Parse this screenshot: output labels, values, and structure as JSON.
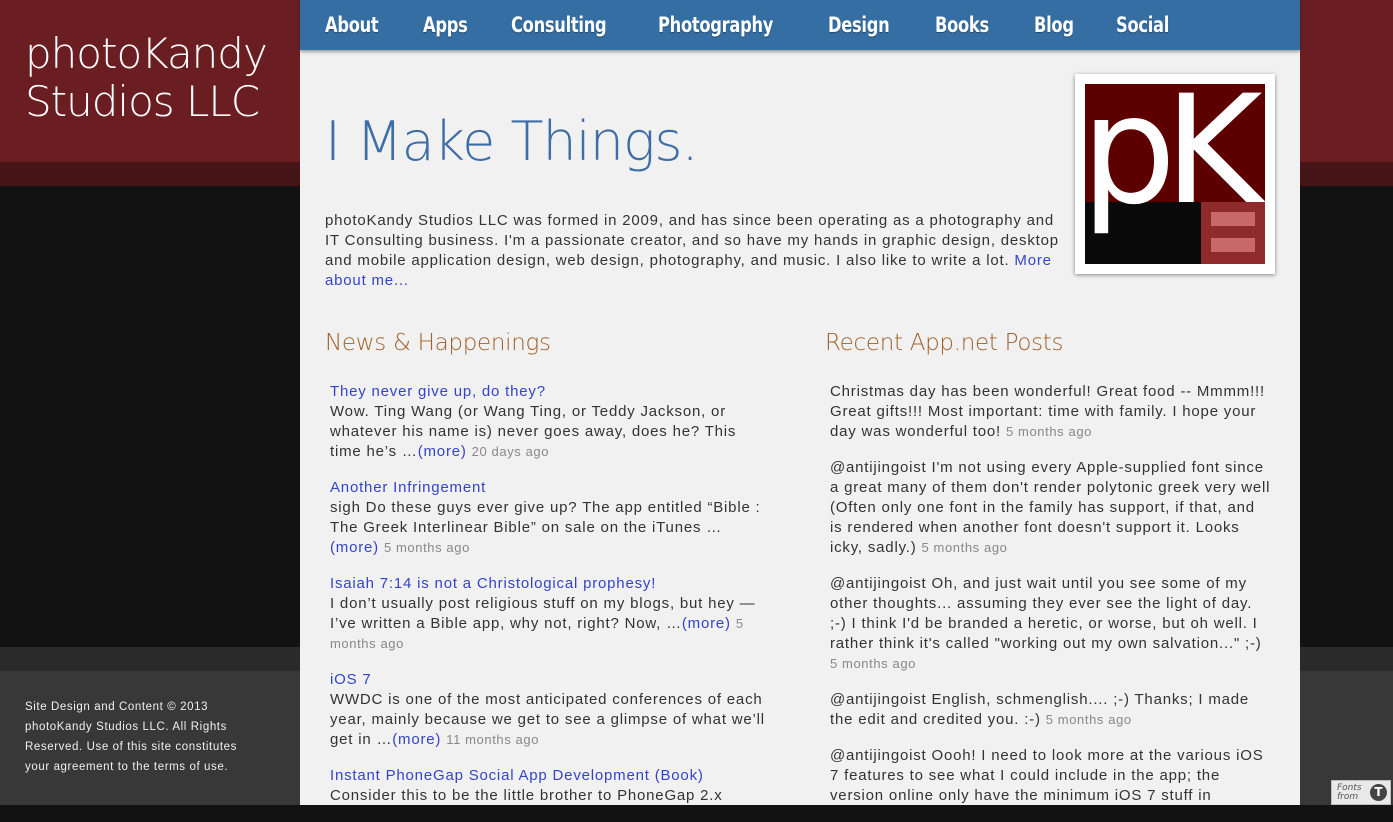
{
  "brand": {
    "title_line1": "photoKandy",
    "title_line2": "Studios LLC"
  },
  "nav": {
    "items": [
      "About",
      "Apps",
      "Consulting",
      "Photography",
      "Design",
      "Books",
      "Blog",
      "Social"
    ]
  },
  "hero": {
    "title": "I Make Things.",
    "intro": "photoKandy Studios LLC was formed in 2009, and has since been operating as a photography and IT Consulting business. I'm a passionate creator, and so have my hands in graphic design, desktop and mobile application design, web design, photography, and music. I also like to write a lot.",
    "more_link": "More about me..."
  },
  "logo": {
    "letters": "pK",
    "colors": {
      "maroon": "#5c0000",
      "black": "#0a0a0a",
      "accent": "#8e2a2c",
      "bar": "#c9686a"
    }
  },
  "news": {
    "heading": "News & Happenings",
    "items": [
      {
        "title": "They never give up, do they?",
        "excerpt": "Wow. Ting Wang (or Wang Ting, or Teddy Jackson, or whatever his name is) never goes away, does he? This time he’s …",
        "more": "(more)",
        "age": "20 days ago"
      },
      {
        "title": "Another Infringement",
        "excerpt": "sigh Do these guys ever give up? The app entitled “Bible : The Greek Interlinear Bible” on sale on the iTunes …",
        "more": "(more)",
        "age": "5 months ago"
      },
      {
        "title": "Isaiah 7:14 is not a Christological prophesy!",
        "excerpt": "I don’t usually post religious stuff on my blogs, but hey — I’ve written a Bible app, why not, right? Now, …",
        "more": "(more)",
        "age": "5 months ago"
      },
      {
        "title": "iOS 7",
        "excerpt": "WWDC is one of the most anticipated conferences of each year, mainly because we get to see a glimpse of what we’ll get in …",
        "more": "(more)",
        "age": "11 months ago"
      },
      {
        "title": "Instant PhoneGap Social App Development (Book)",
        "excerpt": "Consider this to be the little brother to PhoneGap 2.x",
        "more": "",
        "age": ""
      }
    ]
  },
  "posts": {
    "heading": "Recent App.net Posts",
    "items": [
      {
        "text": "Christmas day has been wonderful! Great food -- Mmmm!!! Great gifts!!! Most important: time with family. I hope your day was wonderful too!",
        "age": "5 months ago"
      },
      {
        "text": "@antijingoist I'm not using every Apple-supplied font since a great many of them don't render polytonic greek very well (Often only one font in the family has support, if that, and is rendered when another font doesn't support it. Looks icky, sadly.)",
        "age": "5 months ago"
      },
      {
        "text": "@antijingoist Oh, and just wait until you see some of my other thoughts... assuming they ever see the light of day. ;-) I think I'd be branded a heretic, or worse, but oh well. I rather think it's called \"working out my own salvation...\" ;-)",
        "age": "5 months ago"
      },
      {
        "text": "@antijingoist English, schmenglish.... ;-) Thanks; I made the edit and credited you. :-)",
        "age": "5 months ago"
      },
      {
        "text": "@antijingoist Oooh! I need to look more at the various iOS 7 features to see what I could include in the app; the version online only have the minimum iOS 7 stuff in",
        "age": ""
      }
    ]
  },
  "footer": {
    "text": "Site Design and Content © 2013 photoKandy Studios LLC. All Rights Reserved. Use of this site constitutes your agreement to the terms of use."
  },
  "badge": {
    "line1": "Fonts",
    "line2": "from"
  },
  "colors": {
    "nav_blue": "#356ea3",
    "brand_maroon": "#6b1e22",
    "heading_orange": "#a0622a",
    "link_blue": "#3344cc",
    "hero_blue": "#3e6ea6"
  }
}
